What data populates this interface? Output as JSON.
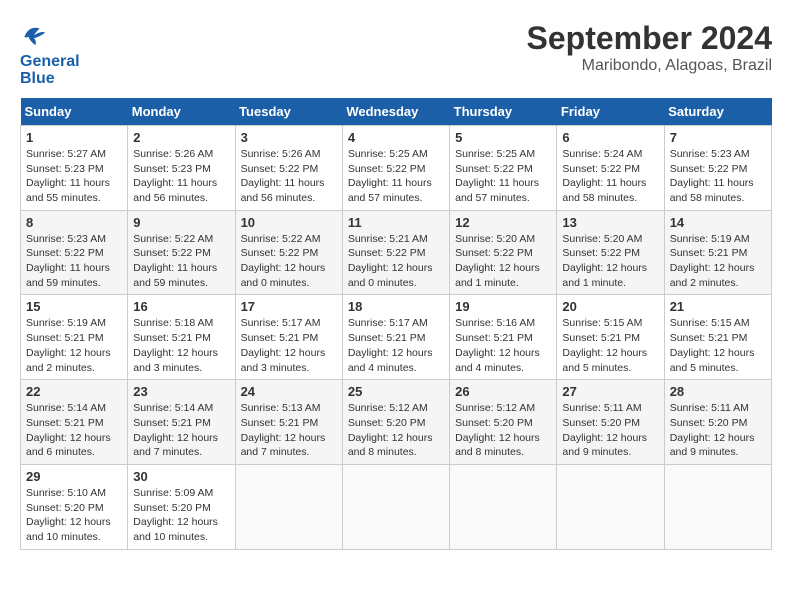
{
  "header": {
    "logo_line1": "General",
    "logo_line2": "Blue",
    "month": "September 2024",
    "location": "Maribondo, Alagoas, Brazil"
  },
  "weekdays": [
    "Sunday",
    "Monday",
    "Tuesday",
    "Wednesday",
    "Thursday",
    "Friday",
    "Saturday"
  ],
  "weeks": [
    [
      {
        "day": "1",
        "sunrise": "5:27 AM",
        "sunset": "5:23 PM",
        "daylight": "11 hours and 55 minutes."
      },
      {
        "day": "2",
        "sunrise": "5:26 AM",
        "sunset": "5:23 PM",
        "daylight": "11 hours and 56 minutes."
      },
      {
        "day": "3",
        "sunrise": "5:26 AM",
        "sunset": "5:22 PM",
        "daylight": "11 hours and 56 minutes."
      },
      {
        "day": "4",
        "sunrise": "5:25 AM",
        "sunset": "5:22 PM",
        "daylight": "11 hours and 57 minutes."
      },
      {
        "day": "5",
        "sunrise": "5:25 AM",
        "sunset": "5:22 PM",
        "daylight": "11 hours and 57 minutes."
      },
      {
        "day": "6",
        "sunrise": "5:24 AM",
        "sunset": "5:22 PM",
        "daylight": "11 hours and 58 minutes."
      },
      {
        "day": "7",
        "sunrise": "5:23 AM",
        "sunset": "5:22 PM",
        "daylight": "11 hours and 58 minutes."
      }
    ],
    [
      {
        "day": "8",
        "sunrise": "5:23 AM",
        "sunset": "5:22 PM",
        "daylight": "11 hours and 59 minutes."
      },
      {
        "day": "9",
        "sunrise": "5:22 AM",
        "sunset": "5:22 PM",
        "daylight": "11 hours and 59 minutes."
      },
      {
        "day": "10",
        "sunrise": "5:22 AM",
        "sunset": "5:22 PM",
        "daylight": "12 hours and 0 minutes."
      },
      {
        "day": "11",
        "sunrise": "5:21 AM",
        "sunset": "5:22 PM",
        "daylight": "12 hours and 0 minutes."
      },
      {
        "day": "12",
        "sunrise": "5:20 AM",
        "sunset": "5:22 PM",
        "daylight": "12 hours and 1 minute."
      },
      {
        "day": "13",
        "sunrise": "5:20 AM",
        "sunset": "5:22 PM",
        "daylight": "12 hours and 1 minute."
      },
      {
        "day": "14",
        "sunrise": "5:19 AM",
        "sunset": "5:21 PM",
        "daylight": "12 hours and 2 minutes."
      }
    ],
    [
      {
        "day": "15",
        "sunrise": "5:19 AM",
        "sunset": "5:21 PM",
        "daylight": "12 hours and 2 minutes."
      },
      {
        "day": "16",
        "sunrise": "5:18 AM",
        "sunset": "5:21 PM",
        "daylight": "12 hours and 3 minutes."
      },
      {
        "day": "17",
        "sunrise": "5:17 AM",
        "sunset": "5:21 PM",
        "daylight": "12 hours and 3 minutes."
      },
      {
        "day": "18",
        "sunrise": "5:17 AM",
        "sunset": "5:21 PM",
        "daylight": "12 hours and 4 minutes."
      },
      {
        "day": "19",
        "sunrise": "5:16 AM",
        "sunset": "5:21 PM",
        "daylight": "12 hours and 4 minutes."
      },
      {
        "day": "20",
        "sunrise": "5:15 AM",
        "sunset": "5:21 PM",
        "daylight": "12 hours and 5 minutes."
      },
      {
        "day": "21",
        "sunrise": "5:15 AM",
        "sunset": "5:21 PM",
        "daylight": "12 hours and 5 minutes."
      }
    ],
    [
      {
        "day": "22",
        "sunrise": "5:14 AM",
        "sunset": "5:21 PM",
        "daylight": "12 hours and 6 minutes."
      },
      {
        "day": "23",
        "sunrise": "5:14 AM",
        "sunset": "5:21 PM",
        "daylight": "12 hours and 7 minutes."
      },
      {
        "day": "24",
        "sunrise": "5:13 AM",
        "sunset": "5:21 PM",
        "daylight": "12 hours and 7 minutes."
      },
      {
        "day": "25",
        "sunrise": "5:12 AM",
        "sunset": "5:20 PM",
        "daylight": "12 hours and 8 minutes."
      },
      {
        "day": "26",
        "sunrise": "5:12 AM",
        "sunset": "5:20 PM",
        "daylight": "12 hours and 8 minutes."
      },
      {
        "day": "27",
        "sunrise": "5:11 AM",
        "sunset": "5:20 PM",
        "daylight": "12 hours and 9 minutes."
      },
      {
        "day": "28",
        "sunrise": "5:11 AM",
        "sunset": "5:20 PM",
        "daylight": "12 hours and 9 minutes."
      }
    ],
    [
      {
        "day": "29",
        "sunrise": "5:10 AM",
        "sunset": "5:20 PM",
        "daylight": "12 hours and 10 minutes."
      },
      {
        "day": "30",
        "sunrise": "5:09 AM",
        "sunset": "5:20 PM",
        "daylight": "12 hours and 10 minutes."
      },
      null,
      null,
      null,
      null,
      null
    ]
  ]
}
